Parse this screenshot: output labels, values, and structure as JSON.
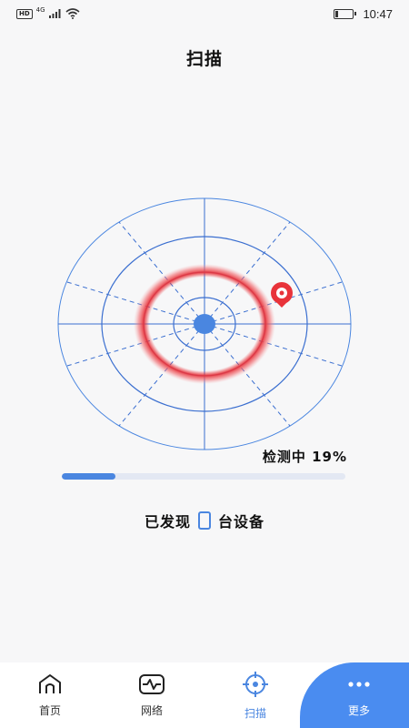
{
  "status_bar": {
    "hd": "HD",
    "network": "4G",
    "time": "10:47",
    "battery_level": 0.15
  },
  "header": {
    "title": "扫描"
  },
  "scan": {
    "progress_text": "检测中 19%",
    "progress_percent": 19,
    "found_prefix": "已发现",
    "found_count": "0",
    "found_suffix": "台设备"
  },
  "tabs": [
    {
      "label": "首页",
      "icon": "home-icon"
    },
    {
      "label": "网络",
      "icon": "network-pulse-icon"
    },
    {
      "label": "扫描",
      "icon": "scan-crosshair-icon",
      "active": true
    },
    {
      "label": "更多",
      "icon": "more-dots-icon"
    }
  ],
  "colors": {
    "accent": "#4a86e0",
    "more_tab_bg": "#4a8cf0",
    "radar_line": "#3b6fd0",
    "pulse_red": "#e8333a"
  }
}
